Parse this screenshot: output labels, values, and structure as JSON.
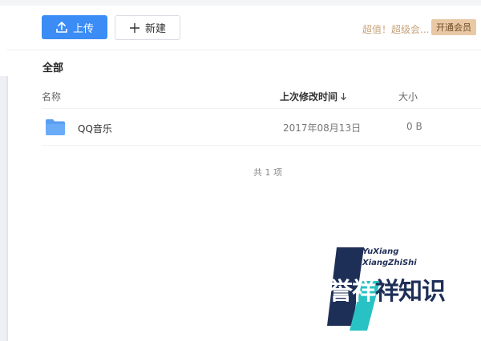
{
  "toolbar": {
    "upload_label": "上传",
    "new_label": "新建",
    "promo_text": "超值！超级会...",
    "vip_button_label": "开通会员"
  },
  "breadcrumb": "全部",
  "columns": {
    "name": "名称",
    "modified": "上次修改时间",
    "size": "大小"
  },
  "files": [
    {
      "name": "QQ音乐",
      "modified": "2017年08月13日",
      "size": "0 B",
      "icon": "folder-icon"
    }
  ],
  "footer": {
    "total": "共 1 项"
  },
  "watermark": {
    "line1": "YuXiang",
    "line2": "XiangZhiShi",
    "brand_a": "誉祥",
    "brand_b": "祥知识"
  },
  "colors": {
    "accent": "#3b8cf5",
    "vip": "#e9c9a5",
    "promo": "#c8a27a",
    "watermark_teal": "#29c2c4",
    "watermark_navy": "#1e2f57"
  }
}
